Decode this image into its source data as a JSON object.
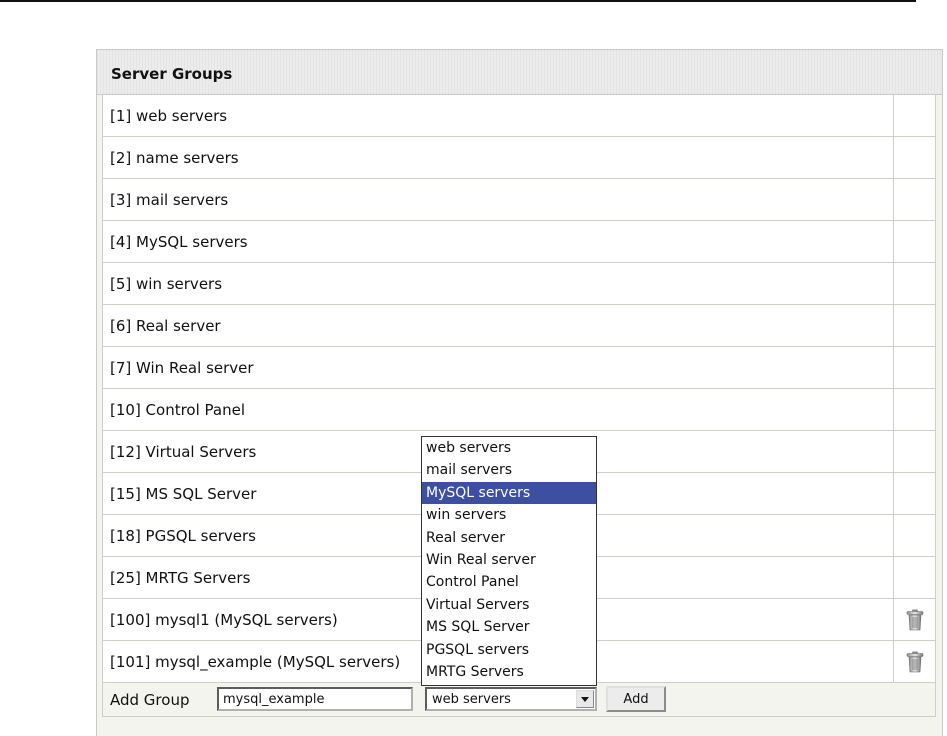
{
  "panel": {
    "title": "Server Groups"
  },
  "groups": [
    {
      "label": "[1] web servers",
      "deletable": false
    },
    {
      "label": "[2] name servers",
      "deletable": false
    },
    {
      "label": "[3] mail servers",
      "deletable": false
    },
    {
      "label": "[4] MySQL servers",
      "deletable": false
    },
    {
      "label": "[5] win servers",
      "deletable": false
    },
    {
      "label": "[6] Real server",
      "deletable": false
    },
    {
      "label": "[7] Win Real server",
      "deletable": false
    },
    {
      "label": "[10] Control Panel",
      "deletable": false
    },
    {
      "label": "[12] Virtual Servers",
      "deletable": false
    },
    {
      "label": "[15] MS SQL Server",
      "deletable": false
    },
    {
      "label": "[18] PGSQL servers",
      "deletable": false
    },
    {
      "label": "[25] MRTG Servers",
      "deletable": false
    },
    {
      "label": "[100] mysql1 (MySQL servers)",
      "deletable": true
    },
    {
      "label": "[101] mysql_example (MySQL servers)",
      "deletable": true
    }
  ],
  "add_form": {
    "label": "Add Group",
    "input_value": "mysql_example",
    "selected_type": "web servers",
    "button_label": "Add"
  },
  "dropdown": {
    "options": [
      "web servers",
      "mail servers",
      "MySQL servers",
      "win servers",
      "Real server",
      "Win Real server",
      "Control Panel",
      "Virtual Servers",
      "MS SQL Server",
      "PGSQL servers",
      "MRTG Servers"
    ],
    "highlighted": "MySQL servers"
  },
  "icons": {
    "delete": "trash-icon",
    "select_arrow": "chevron-down-icon"
  },
  "colors": {
    "highlight": "#3d4fa1",
    "panel_background": "#f4f4ef"
  }
}
